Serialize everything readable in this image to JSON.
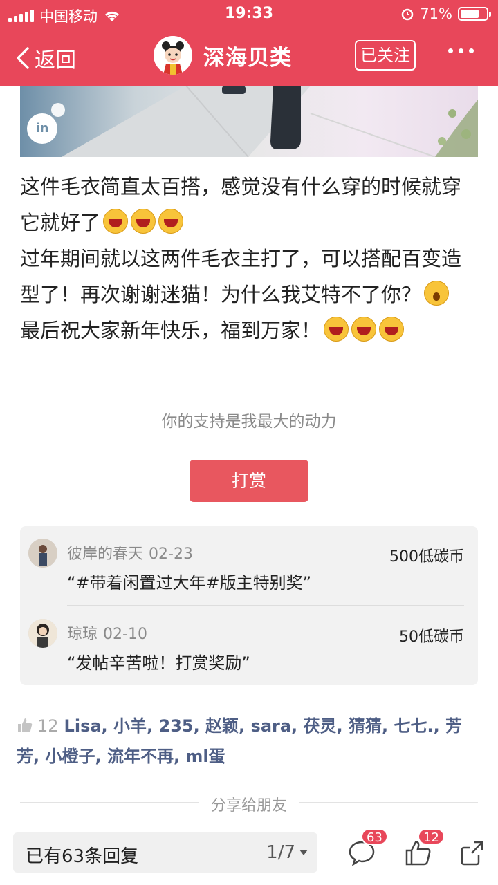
{
  "status_bar": {
    "carrier": "中国移动",
    "time": "19:33",
    "battery": "71%",
    "battery_level": 0.71
  },
  "nav": {
    "back_label": "返回",
    "title": "深海贝类",
    "follow_label": "已关注"
  },
  "photo": {
    "watermark": "in"
  },
  "article": {
    "paragraphs": [
      "这件毛衣简直太百搭，感觉没有什么穿的时候就穿它就好了",
      "过年期间就以这两件毛衣主打了，可以搭配百变造型了！再次谢谢迷猫！为什么我艾特不了你？",
      "最后祝大家新年快乐，福到万家！"
    ]
  },
  "support_text": "你的支持是我最大的动力",
  "reward_button": "打赏",
  "rewards": [
    {
      "name": "彼岸的春天",
      "date": "02-23",
      "amount": "500低碳币",
      "message": "“#带着闲置过大年#版主特别奖”"
    },
    {
      "name": "琼琼",
      "date": "02-10",
      "amount": "50低碳币",
      "message": "“发帖辛苦啦！打赏奖励”"
    }
  ],
  "likes": {
    "count": "12",
    "names": "Lisa, 小羊, 235, 赵颖, sara, 茯灵, 猜猜, 七七., 芳芳, 小橙子, 流年不再, ml蛋"
  },
  "share_label": "分享给朋友",
  "bottom_bar": {
    "reply_label": "已有63条回复",
    "page_indicator": "1/7",
    "comment_badge": "63",
    "like_badge": "12"
  },
  "colors": {
    "brand": "#e8475a",
    "reward_button": "#e8575f",
    "like_names": "#4e5e85"
  }
}
